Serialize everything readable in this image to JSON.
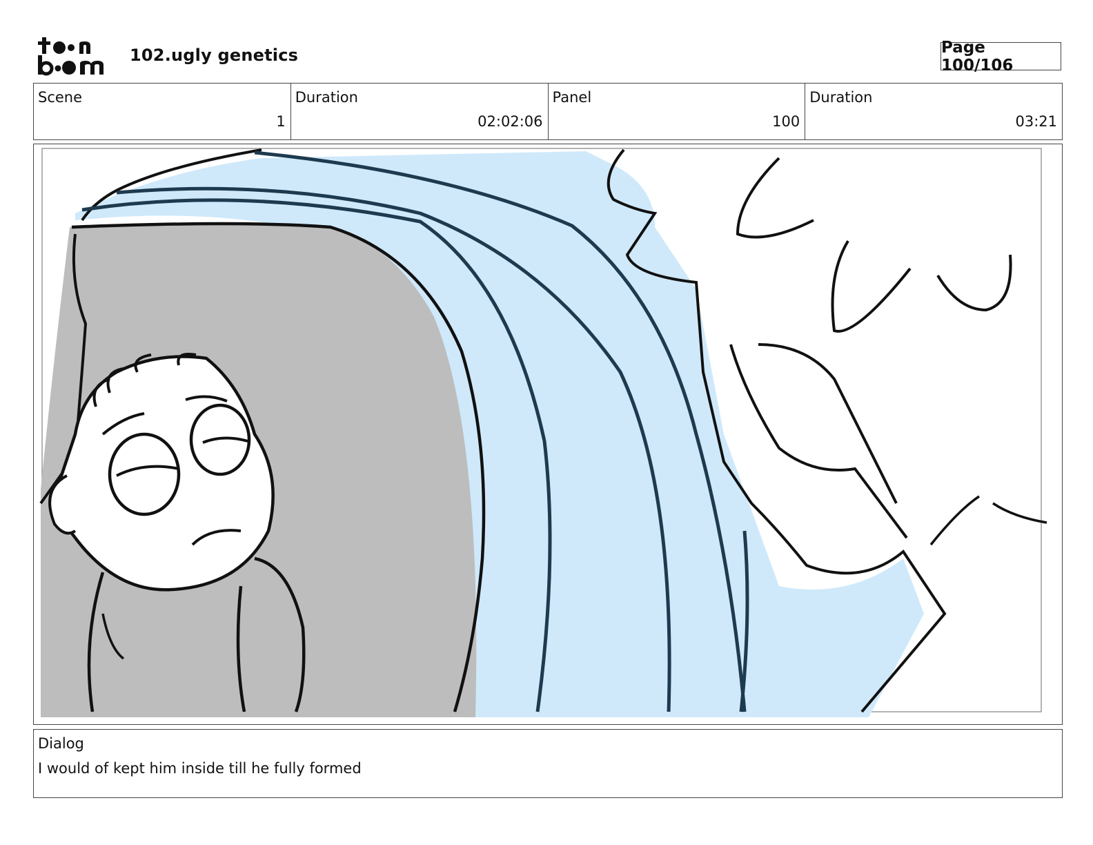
{
  "header": {
    "logo_name": "toon-boom-logo",
    "project_title": "102.ugly genetics",
    "page_label": "Page 100/106"
  },
  "info": {
    "scene_label": "Scene",
    "scene_value": "1",
    "scene_duration_label": "Duration",
    "scene_duration_value": "02:02:06",
    "panel_label": "Panel",
    "panel_value": "100",
    "panel_duration_label": "Duration",
    "panel_duration_value": "03:21"
  },
  "dialog": {
    "label": "Dialog",
    "text": "I would of kept him inside till he fully formed"
  },
  "colors": {
    "border": "#444444",
    "shadow_gray": "#bdbdbd",
    "sky_blue": "#cfe9fb",
    "stroke_navy": "#1e3a4f",
    "ink": "#111111"
  }
}
